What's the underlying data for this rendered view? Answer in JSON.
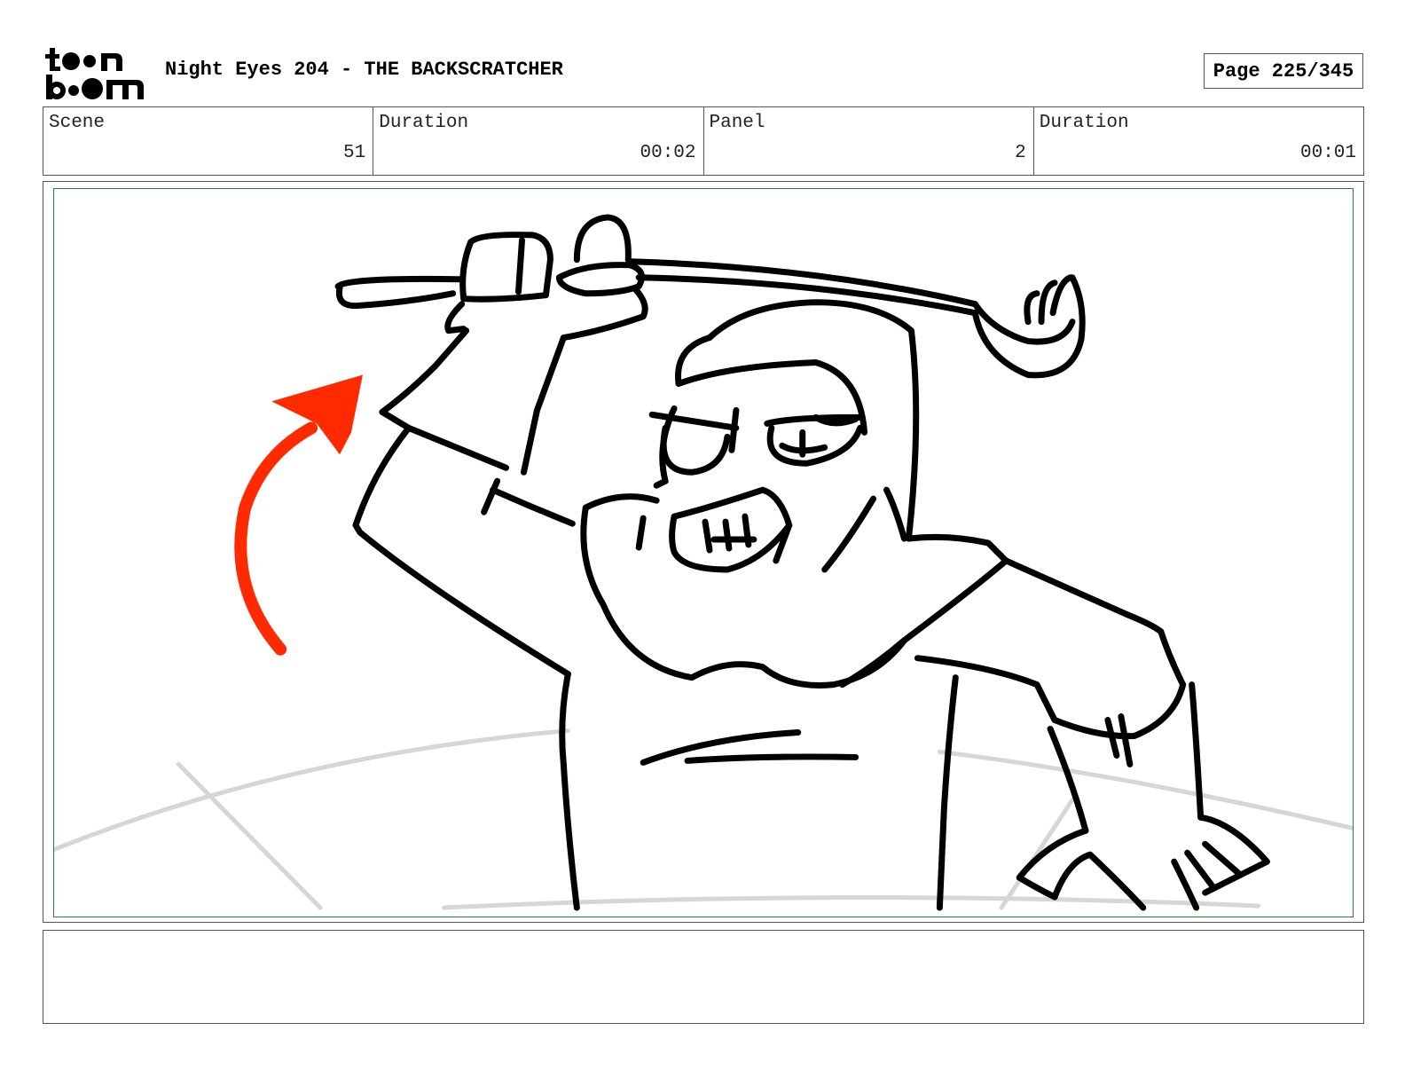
{
  "header": {
    "logo": {
      "line1": "toon",
      "line2": "boom"
    },
    "title": "Night Eyes 204 - THE BACKSCRATCHER",
    "page_label": "Page 225/345"
  },
  "info": {
    "scene_label": "Scene",
    "scene_value": "51",
    "scene_duration_label": "Duration",
    "scene_duration_value": "00:02",
    "panel_label": "Panel",
    "panel_value": "2",
    "panel_duration_label": "Duration",
    "panel_duration_value": "00:01"
  },
  "drawing": {
    "description_icon": "storyboard-sketch",
    "arrow_color": "#ff2a00",
    "border_color": "#2e7d32"
  },
  "notes": {
    "text": ""
  }
}
